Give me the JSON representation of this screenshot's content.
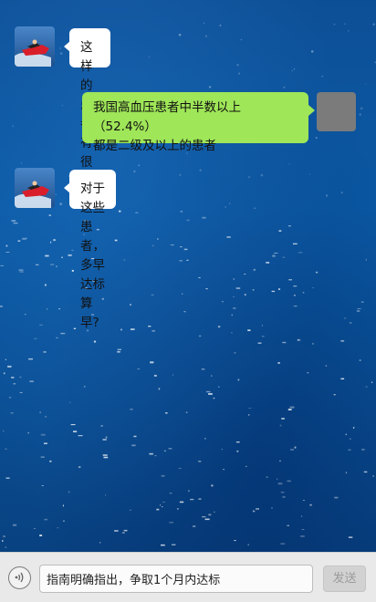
{
  "messages": [
    {
      "sender": "other",
      "avatar_icon": "speedboat-icon",
      "text": "这样的患者有很多吗?"
    },
    {
      "sender": "self",
      "lines": [
        "我国高血压患者中半数以上（52.4%）",
        "都是二级及以上的患者"
      ]
    },
    {
      "sender": "other",
      "avatar_icon": "speedboat-icon",
      "text": "对于这些患者，多早达标算早?"
    }
  ],
  "input_bar": {
    "voice_icon": "voice-icon",
    "input_value": "指南明确指出，争取1个月内达标",
    "send_label": "发送"
  },
  "colors": {
    "incoming_bubble": "#ffffff",
    "outgoing_bubble": "#9fe658",
    "background": "#0b5aa6",
    "self_avatar": "#7b7b7b"
  }
}
